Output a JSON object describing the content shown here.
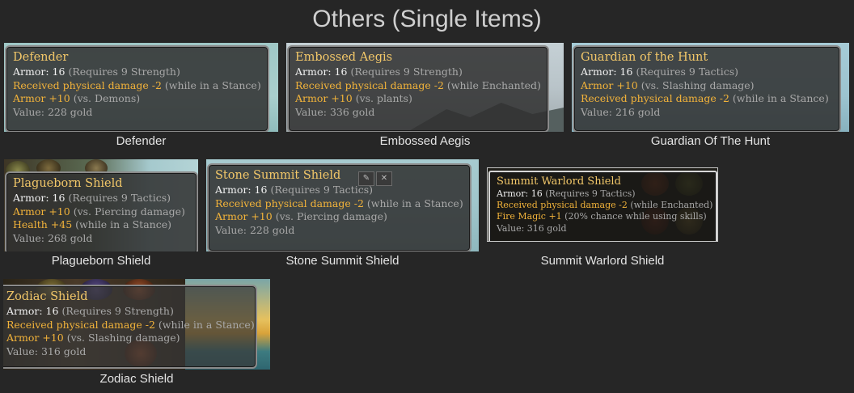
{
  "page_title": "Others (Single Items)",
  "items": [
    {
      "caption": "Defender",
      "name": "Defender",
      "armor": "Armor: 16",
      "requires": "(Requires 9 Strength)",
      "mod1": "Received physical damage -2",
      "mod1_cond": "(while in a Stance)",
      "mod2": "Armor +10",
      "mod2_cond": "(vs. Demons)",
      "value": "Value: 228 gold"
    },
    {
      "caption": "Embossed Aegis",
      "name": "Embossed Aegis",
      "armor": "Armor: 16",
      "requires": "(Requires 9 Strength)",
      "mod1": "Received physical damage -2",
      "mod1_cond": "(while Enchanted)",
      "mod2": "Armor +10",
      "mod2_cond": "(vs. plants)",
      "value": "Value: 336 gold"
    },
    {
      "caption": "Guardian Of The Hunt",
      "name": "Guardian of the Hunt",
      "armor": "Armor: 16",
      "requires": "(Requires 9 Tactics)",
      "mod1": "Armor +10",
      "mod1_cond": "(vs. Slashing damage)",
      "mod2": "Received physical damage -2",
      "mod2_cond": "(while in a Stance)",
      "value": "Value: 216 gold"
    },
    {
      "caption": "Plagueborn Shield",
      "name": "Plagueborn Shield",
      "armor": "Armor: 16",
      "requires": "(Requires 9 Tactics)",
      "mod1": "Armor +10",
      "mod1_cond": "(vs. Piercing damage)",
      "mod2": "Health +45",
      "mod2_cond": "(while in a Stance)",
      "value": "Value: 268 gold"
    },
    {
      "caption": "Stone Summit Shield",
      "name": "Stone Summit Shield",
      "armor": "Armor: 16",
      "requires": "(Requires 9 Tactics)",
      "mod1": "Received physical damage -2",
      "mod1_cond": "(while in a Stance)",
      "mod2": "Armor +10",
      "mod2_cond": "(vs. Piercing damage)",
      "value": "Value: 228 gold"
    },
    {
      "caption": "Summit Warlord Shield",
      "name": "Summit Warlord Shield",
      "armor": "Armor: 16",
      "requires": "(Requires 9 Tactics)",
      "mod1": "Received physical damage -2",
      "mod1_cond": "(while Enchanted)",
      "mod2": "Fire Magic +1",
      "mod2_cond": "(20% chance while using skills)",
      "value": "Value: 316 gold"
    },
    {
      "caption": "Zodiac Shield",
      "name": "Zodiac Shield",
      "armor": "Armor: 16",
      "requires": "(Requires 9 Strength)",
      "mod1": "Received physical damage -2",
      "mod1_cond": "(while in a Stance)",
      "mod2": "Armor +10",
      "mod2_cond": "(vs. Slashing damage)",
      "value": "Value: 316 gold"
    }
  ],
  "colors": {
    "background": "#262626",
    "item_name": "#f2c769",
    "modifier": "#f2b33a",
    "condition": "#a8a8a8"
  }
}
